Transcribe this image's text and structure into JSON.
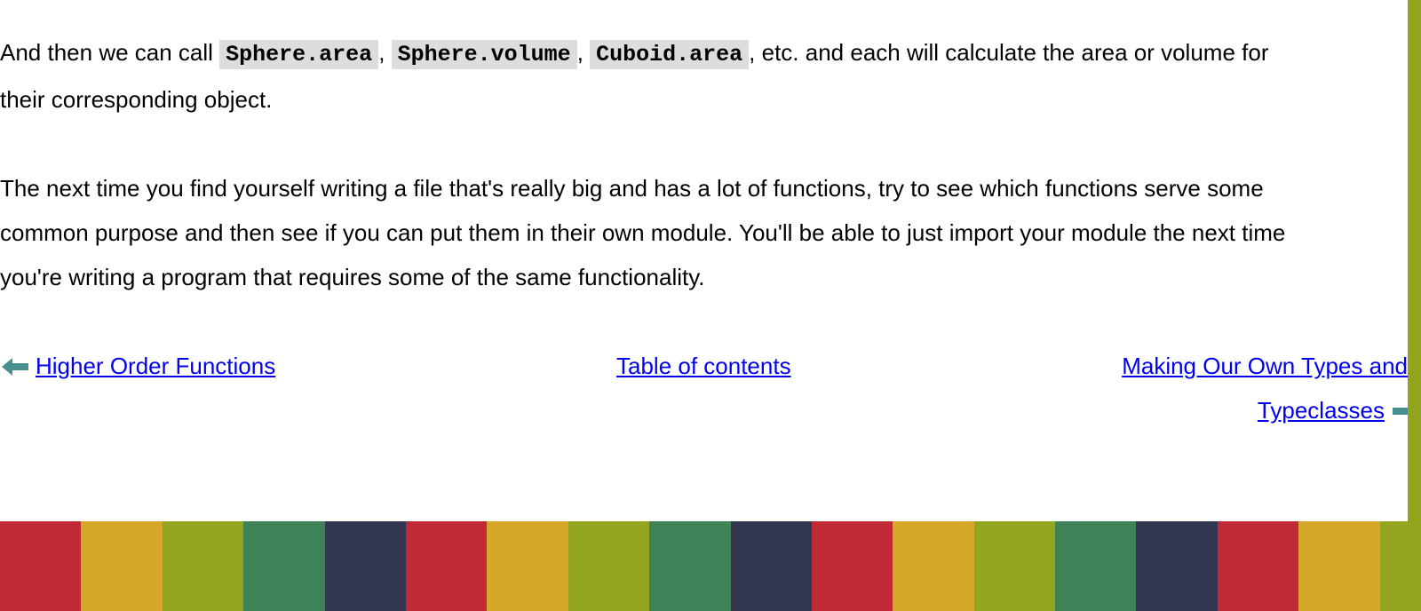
{
  "paragraph1": {
    "text_before": "And then we can call ",
    "code1": "Sphere.area",
    "sep1": ", ",
    "code2": "Sphere.volume",
    "sep2": ", ",
    "code3": "Cuboid.area",
    "text_after": ", etc. and each will calculate the area or volume for",
    "line2": "their corresponding object."
  },
  "paragraph2": {
    "line1": "The next time you find yourself writing a file that's really big and has a lot of functions, try to see which functions serve some",
    "line2": "common purpose and then see if you can put them in their own module. You'll be able to just import your module the next time",
    "line3": "you're writing a program that requires some of the same functionality."
  },
  "navigation": {
    "prev_label": "Higher Order Functions",
    "toc_label": "Table of contents",
    "next_label_line1": "Making Our Own Types and",
    "next_label_line2": "Typeclasses",
    "prev_icon": "left-arrow-icon",
    "next_icon": "right-arrow-icon"
  },
  "colors": {
    "link": "#0000ee",
    "code_background": "#dddddd",
    "arrow": "#4a8f8f",
    "right_stripe": "#93a51f",
    "footer_stripes": [
      "#c02a35",
      "#d6a829",
      "#93a51f",
      "#3f8257",
      "#323650"
    ]
  }
}
